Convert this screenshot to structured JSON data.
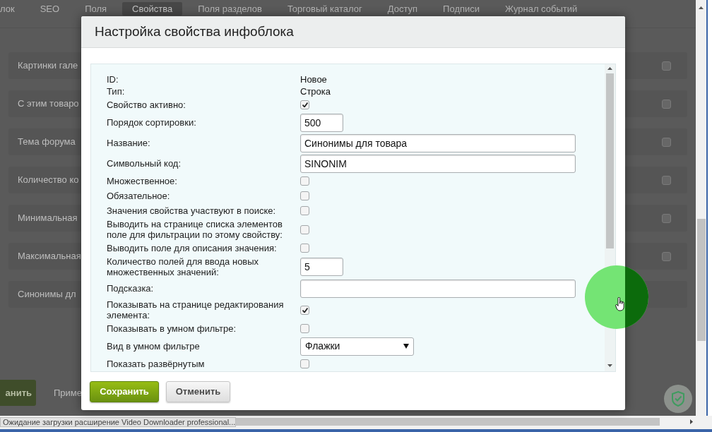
{
  "background_page": {
    "tabs": [
      {
        "label": "лок",
        "selected": false
      },
      {
        "label": "SEO",
        "selected": false
      },
      {
        "label": "Поля",
        "selected": false
      },
      {
        "label": "Свойства",
        "selected": true
      },
      {
        "label": "Поля разделов",
        "selected": false
      },
      {
        "label": "Торговый каталог",
        "selected": false
      },
      {
        "label": "Доступ",
        "selected": false
      },
      {
        "label": "Подписи",
        "selected": false
      },
      {
        "label": "Журнал событий",
        "selected": false
      }
    ],
    "rows": [
      {
        "label": "Картинки гале",
        "checked": false
      },
      {
        "label": "С этим товаро",
        "checked": false
      },
      {
        "label": "Тема форума",
        "checked": false
      },
      {
        "label": "Количество ко",
        "checked": false
      },
      {
        "label": "Минимальная",
        "checked": false
      },
      {
        "label": "Максимальная",
        "checked": false
      },
      {
        "label": "Синонимы дл"
      }
    ],
    "buttons": [
      {
        "label": "анить",
        "kind": "primary"
      },
      {
        "label": "Приме",
        "kind": "plain"
      }
    ]
  },
  "dialog": {
    "title": "Настройка свойства инфоблока",
    "fields": [
      {
        "label": "ID:",
        "kind": "text",
        "value": "Новое"
      },
      {
        "label": "Тип:",
        "kind": "text",
        "value": "Строка"
      },
      {
        "label": "Свойство активно:",
        "kind": "checkbox",
        "checked": true
      },
      {
        "label": "Порядок сортировки:",
        "kind": "short_input",
        "value": "500"
      },
      {
        "label": "Название:",
        "kind": "wide_input",
        "value": "Синонимы для товара"
      },
      {
        "label": "Символьный код:",
        "kind": "wide_input",
        "value": "SINONIM"
      },
      {
        "label": "Множественное:",
        "kind": "checkbox",
        "checked": false
      },
      {
        "label": "Обязательное:",
        "kind": "checkbox",
        "checked": false
      },
      {
        "label": "Значения свойства участвуют в поиске:",
        "kind": "checkbox",
        "checked": false
      },
      {
        "label": "Выводить на странице списка элементов поле для фильтрации по этому свойству:",
        "kind": "checkbox",
        "checked": false
      },
      {
        "label": "Выводить поле для описания значения:",
        "kind": "checkbox",
        "checked": false
      },
      {
        "label": "Количество полей для ввода новых множественных значений:",
        "kind": "short_input",
        "value": "5"
      },
      {
        "label": "Подсказка:",
        "kind": "wide_input"
      },
      {
        "label": "Показывать на странице редактирования элемента:",
        "kind": "checkbox",
        "checked": true
      },
      {
        "label": "Показывать в умном фильтре:",
        "kind": "checkbox",
        "checked": false
      },
      {
        "label": "Вид в умном фильтре",
        "kind": "select",
        "value": "Флажки"
      },
      {
        "label": "Показать развёрнутым",
        "kind": "checkbox",
        "checked": false
      }
    ],
    "buttons": [
      {
        "label": "Сохранить",
        "kind": "primary"
      },
      {
        "label": "Отменить",
        "kind": "secondary"
      }
    ]
  },
  "status_bar": {
    "text": "Ожидание загрузки расширение Video Downloader professional..."
  }
}
